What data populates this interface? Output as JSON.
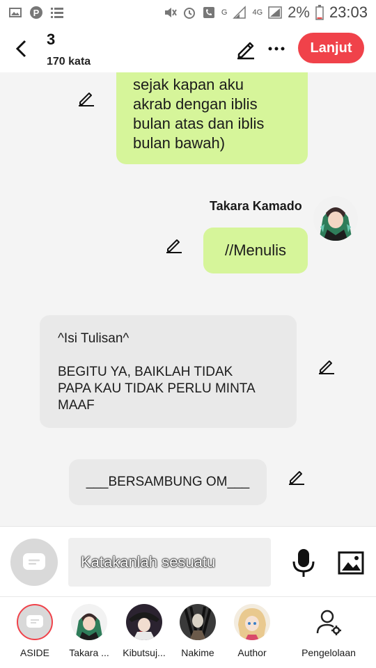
{
  "status_bar": {
    "battery": "2%",
    "time": "23:03",
    "network_labels": [
      "G",
      "4G"
    ]
  },
  "header": {
    "title": "3",
    "word_count": "170 kata",
    "next_label": "Lanjut"
  },
  "chat": {
    "messages": [
      {
        "type": "green",
        "text_lines": [
          "sejak kapan aku",
          "akrab dengan iblis",
          "bulan atas dan iblis",
          "bulan bawah)"
        ]
      },
      {
        "type": "green",
        "speaker": "Takara Kamado",
        "text": "//Menulis"
      },
      {
        "type": "grey",
        "heading": "^Isi Tulisan^",
        "body_lines": [
          "BEGITU YA, BAIKLAH TIDAK",
          "PAPA KAU TIDAK PERLU MINTA",
          "MAAF"
        ]
      },
      {
        "type": "grey",
        "text": "___BERSAMBUNG OM___"
      }
    ]
  },
  "input": {
    "placeholder": "Katakanlah sesuatu"
  },
  "characters": [
    {
      "name": "ASIDE",
      "icon": "aside-icon"
    },
    {
      "name": "Takara ...",
      "icon": "avatar"
    },
    {
      "name": "Kibutsuj...",
      "icon": "avatar"
    },
    {
      "name": "Nakime",
      "icon": "avatar"
    },
    {
      "name": "Author",
      "icon": "avatar"
    },
    {
      "name": "Pengelolaan",
      "icon": "manage-user-icon"
    }
  ],
  "colors": {
    "accent": "#f0424a",
    "bubble_green": "#d6f59a",
    "bubble_grey": "#e9e9e9"
  }
}
